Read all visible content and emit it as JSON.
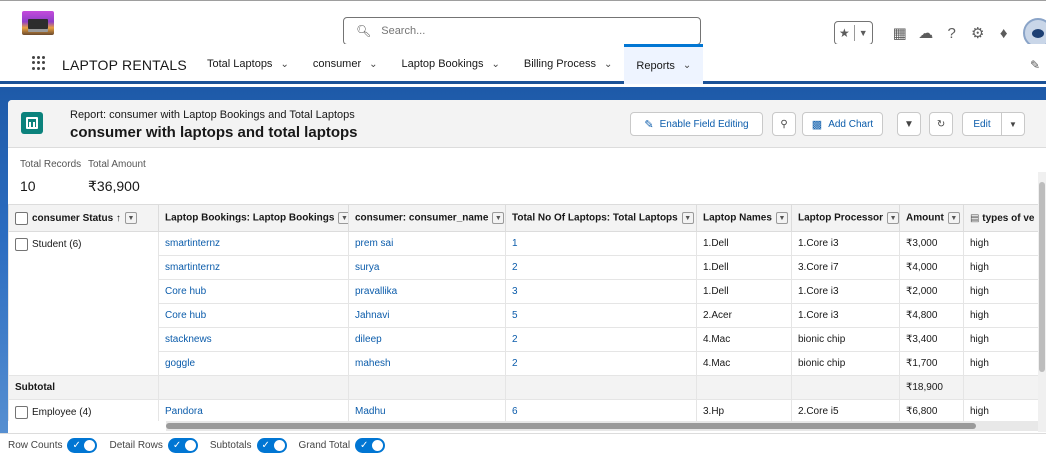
{
  "search": {
    "placeholder": "Search..."
  },
  "header": {
    "icons": [
      "favorites-star-icon",
      "chevron-down-icon",
      "add-icon",
      "cloud-icon",
      "help-icon",
      "gear-icon",
      "bell-icon"
    ]
  },
  "nav": {
    "app_name": "LAPTOP RENTALS",
    "tabs": [
      {
        "label": "Total Laptops"
      },
      {
        "label": "consumer"
      },
      {
        "label": "Laptop Bookings"
      },
      {
        "label": "Billing Process"
      },
      {
        "label": "Reports"
      }
    ],
    "active_tab": "Reports"
  },
  "report": {
    "type_label": "Report: consumer with Laptop Bookings and Total Laptops",
    "title": "consumer with laptops and total laptops",
    "buttons": {
      "enable_field_editing": "Enable Field Editing",
      "add_chart": "Add Chart",
      "edit": "Edit"
    }
  },
  "summary": {
    "total_records_label": "Total Records",
    "total_records_value": "10",
    "total_amount_label": "Total Amount",
    "total_amount_value": "₹36,900"
  },
  "table": {
    "columns": [
      "consumer Status ↑",
      "Laptop Bookings: Laptop Bookings",
      "consumer: consumer_name",
      "Total No Of Laptops: Total Laptops",
      "Laptop Names",
      "Laptop Processor",
      "Amount",
      "types of ve"
    ],
    "groups": [
      {
        "label": "Student (6)",
        "rows": [
          [
            "smartinternz",
            "prem sai",
            "1",
            "1.Dell",
            "1.Core i3",
            "₹3,000",
            "high"
          ],
          [
            "smartinternz",
            "surya",
            "2",
            "1.Dell",
            "3.Core i7",
            "₹4,000",
            "high"
          ],
          [
            "Core hub",
            "pravallika",
            "3",
            "1.Dell",
            "1.Core i3",
            "₹2,000",
            "high"
          ],
          [
            "Core hub",
            "Jahnavi",
            "5",
            "2.Acer",
            "1.Core i3",
            "₹4,800",
            "high"
          ],
          [
            "stacknews",
            "dileep",
            "2",
            "4.Mac",
            "bionic chip",
            "₹3,400",
            "high"
          ],
          [
            "goggle",
            "mahesh",
            "2",
            "4.Mac",
            "bionic chip",
            "₹1,700",
            "high"
          ]
        ],
        "subtotal_label": "Subtotal",
        "subtotal_amount": "₹18,900"
      },
      {
        "label": "Employee (4)",
        "rows": [
          [
            "Pandora",
            "Madhu",
            "6",
            "3.Hp",
            "2.Core i5",
            "₹6,800",
            "high"
          ]
        ]
      }
    ]
  },
  "footer": {
    "toggles": [
      {
        "label": "Row Counts",
        "on": true
      },
      {
        "label": "Detail Rows",
        "on": true
      },
      {
        "label": "Subtotals",
        "on": true
      },
      {
        "label": "Grand Total",
        "on": true
      }
    ]
  }
}
